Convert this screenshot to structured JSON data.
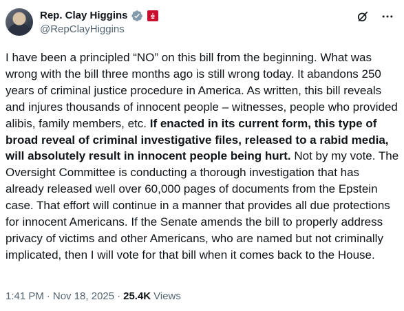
{
  "author": {
    "display_name": "Rep. Clay Higgins",
    "handle": "@RepClayHiggins"
  },
  "tweet": {
    "part1": "I have been a principled “NO” on this bill from the beginning. What was wrong with the bill three months ago is still wrong today. It abandons 250 years of criminal justice procedure in America. As written, this bill reveals and injures thousands of innocent people – witnesses, people who provided alibis, family members, etc. ",
    "bold": "If enacted in its current form, this type of broad reveal of criminal investigative files, released to a rabid media, will absolutely result in innocent people being hurt.",
    "part2": " Not by my vote. The Oversight Committee is conducting a thorough investigation that has already released well over 60,000 pages of documents from the Epstein case. That effort will continue in a manner that provides all due protections for innocent Americans. If the Senate amends the bill to properly address privacy of victims and other Americans, who are named but not criminally implicated, then I will vote for that bill when it comes back to the House."
  },
  "meta": {
    "time": "1:41 PM",
    "dot1": "·",
    "date": "Nov 18, 2025",
    "dot2": "·",
    "views_count": "25.4K",
    "views_label": "Views"
  },
  "icons": {
    "verified": "verified-badge-icon",
    "affiliation": "government-affiliation-icon",
    "grok": "grok-icon",
    "more": "more-options-icon"
  },
  "colors": {
    "verified_badge": "#829aab",
    "affiliation_badge": "#c8102e",
    "secondary_text": "#536471",
    "primary_text": "#0f1419"
  }
}
